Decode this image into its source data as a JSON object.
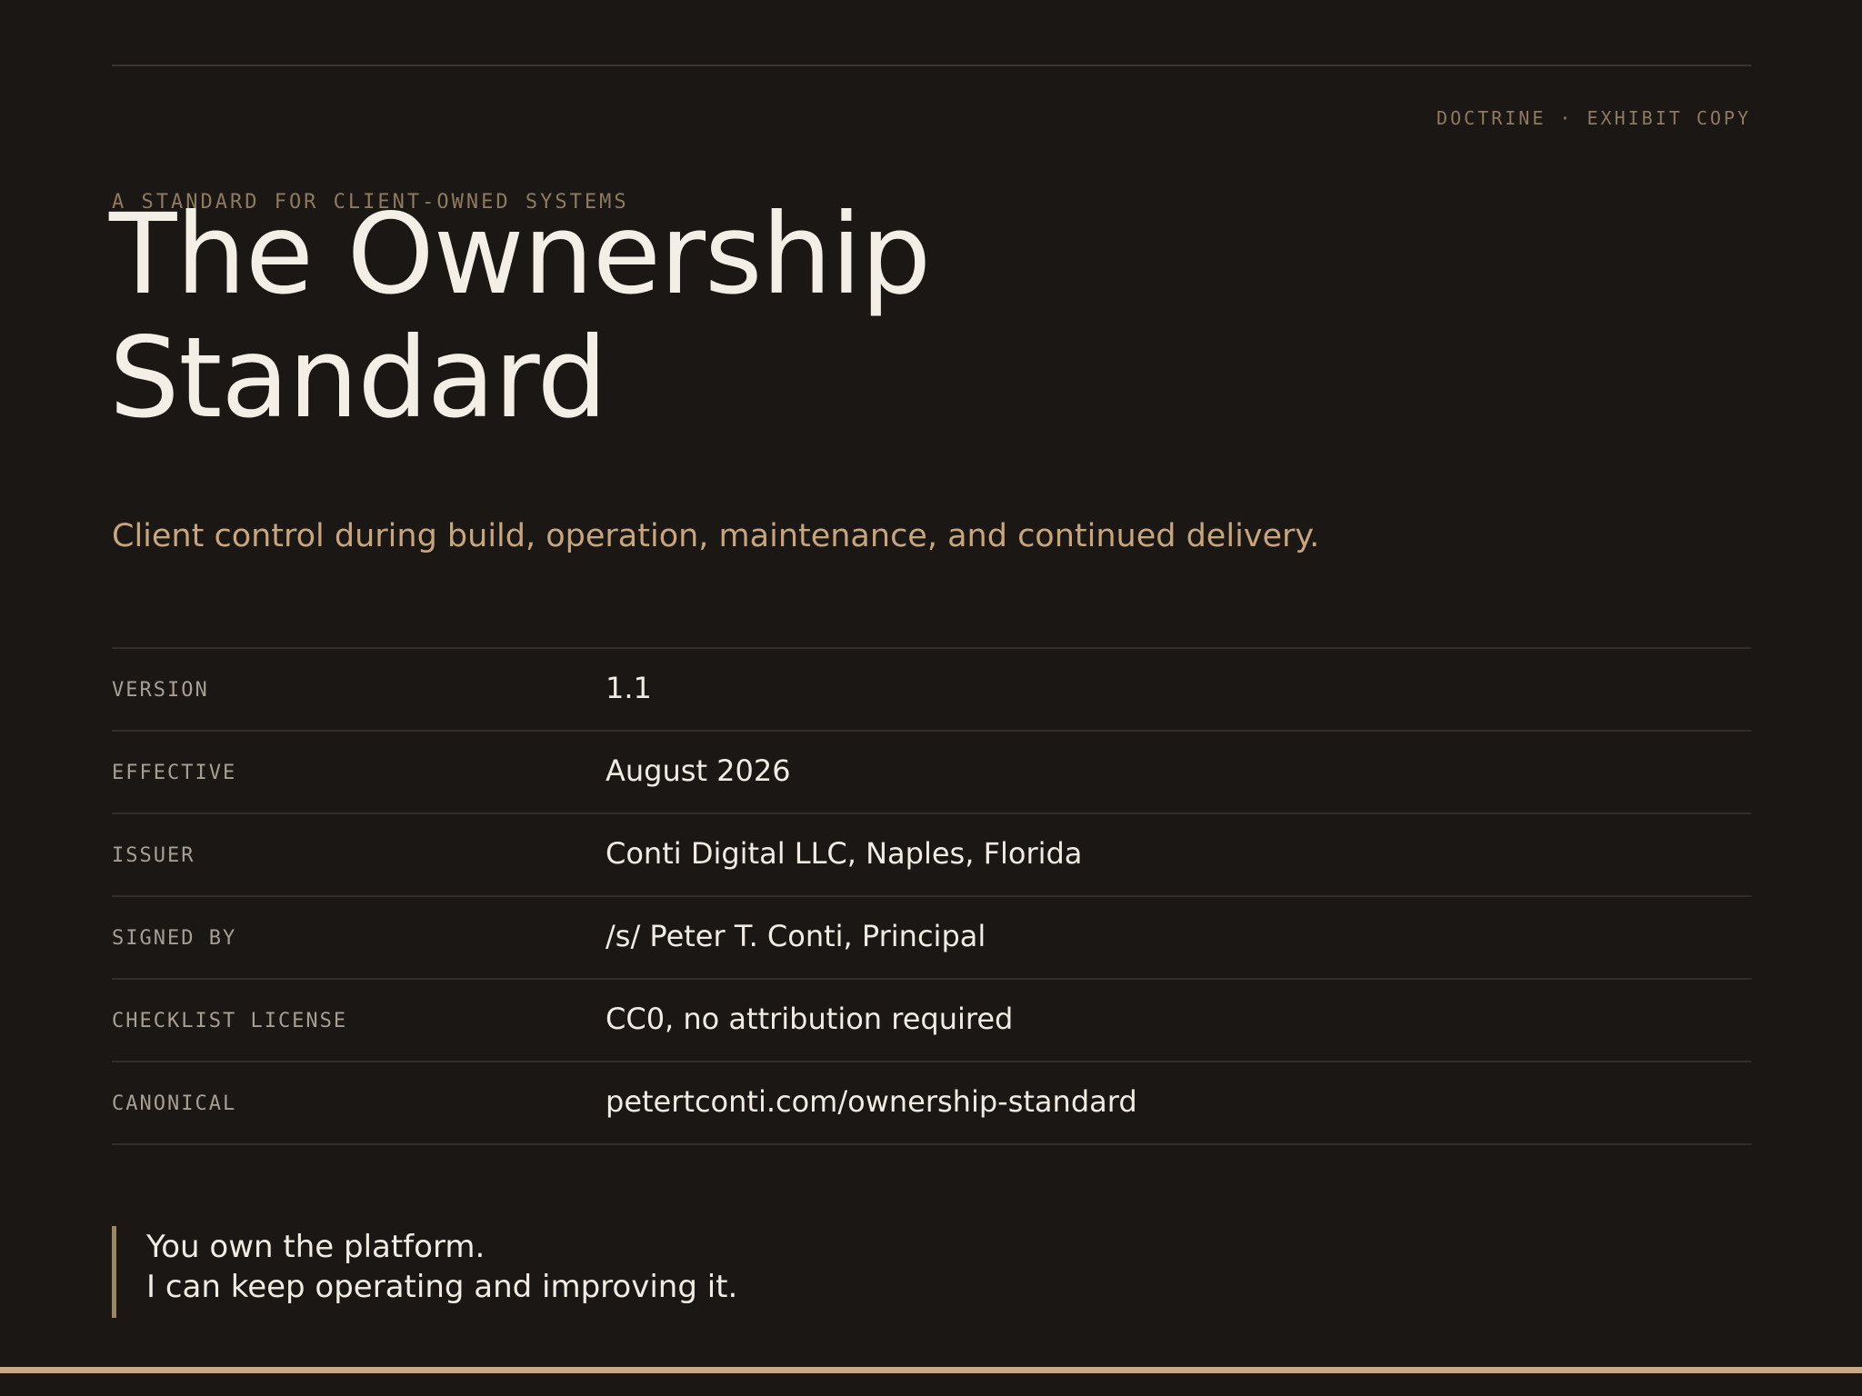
{
  "header": {
    "exhibit_tag": "DOCTRINE · EXHIBIT COPY",
    "eyebrow": "A STANDARD FOR CLIENT-OWNED SYSTEMS",
    "title_line1": "The Ownership",
    "title_line2": "Standard",
    "subtitle": "Client control during build, operation, maintenance, and continued delivery."
  },
  "meta": [
    {
      "key": "VERSION",
      "value": "1.1"
    },
    {
      "key": "EFFECTIVE",
      "value": "August 2026"
    },
    {
      "key": "ISSUER",
      "value": "Conti Digital LLC, Naples, Florida"
    },
    {
      "key": "SIGNED BY",
      "value": "/s/ Peter T. Conti, Principal"
    },
    {
      "key": "CHECKLIST LICENSE",
      "value": "CC0, no attribution required"
    },
    {
      "key": "CANONICAL",
      "value": "petertconti.com/ownership-standard"
    }
  ],
  "quote": {
    "line1": "You own the platform.",
    "line2": "I can keep operating and improving it."
  },
  "colors": {
    "background": "#1a1714",
    "accent": "#c8a57c",
    "muted": "#8e7a5f",
    "text": "#f1ece3"
  }
}
